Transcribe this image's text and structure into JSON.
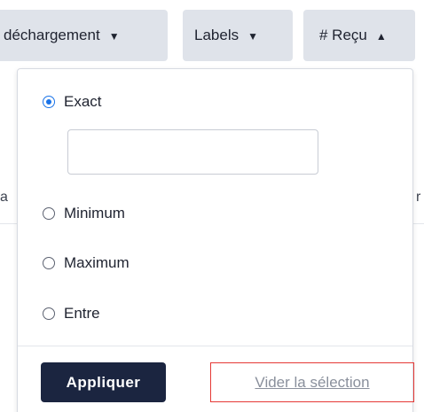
{
  "filters": {
    "discharge": {
      "label": "déchargement",
      "caret": "▼"
    },
    "labels": {
      "label": "Labels",
      "caret": "▼"
    },
    "received": {
      "label": "# Reçu",
      "caret": "▲"
    }
  },
  "background": {
    "left_fragment": "a",
    "right_fragment": "r"
  },
  "dropdown": {
    "options": [
      {
        "label": "Exact",
        "checked": true
      },
      {
        "label": "Minimum",
        "checked": false
      },
      {
        "label": "Maximum",
        "checked": false
      },
      {
        "label": "Entre",
        "checked": false
      }
    ],
    "exact_input": {
      "value": "",
      "placeholder": ""
    },
    "apply_label": "Appliquer",
    "clear_label": "Vider la sélection"
  },
  "colors": {
    "chip_bg": "#dfe3ea",
    "primary_button": "#1b2540",
    "radio_accent": "#1a73e8",
    "highlight_border": "#e53935"
  }
}
